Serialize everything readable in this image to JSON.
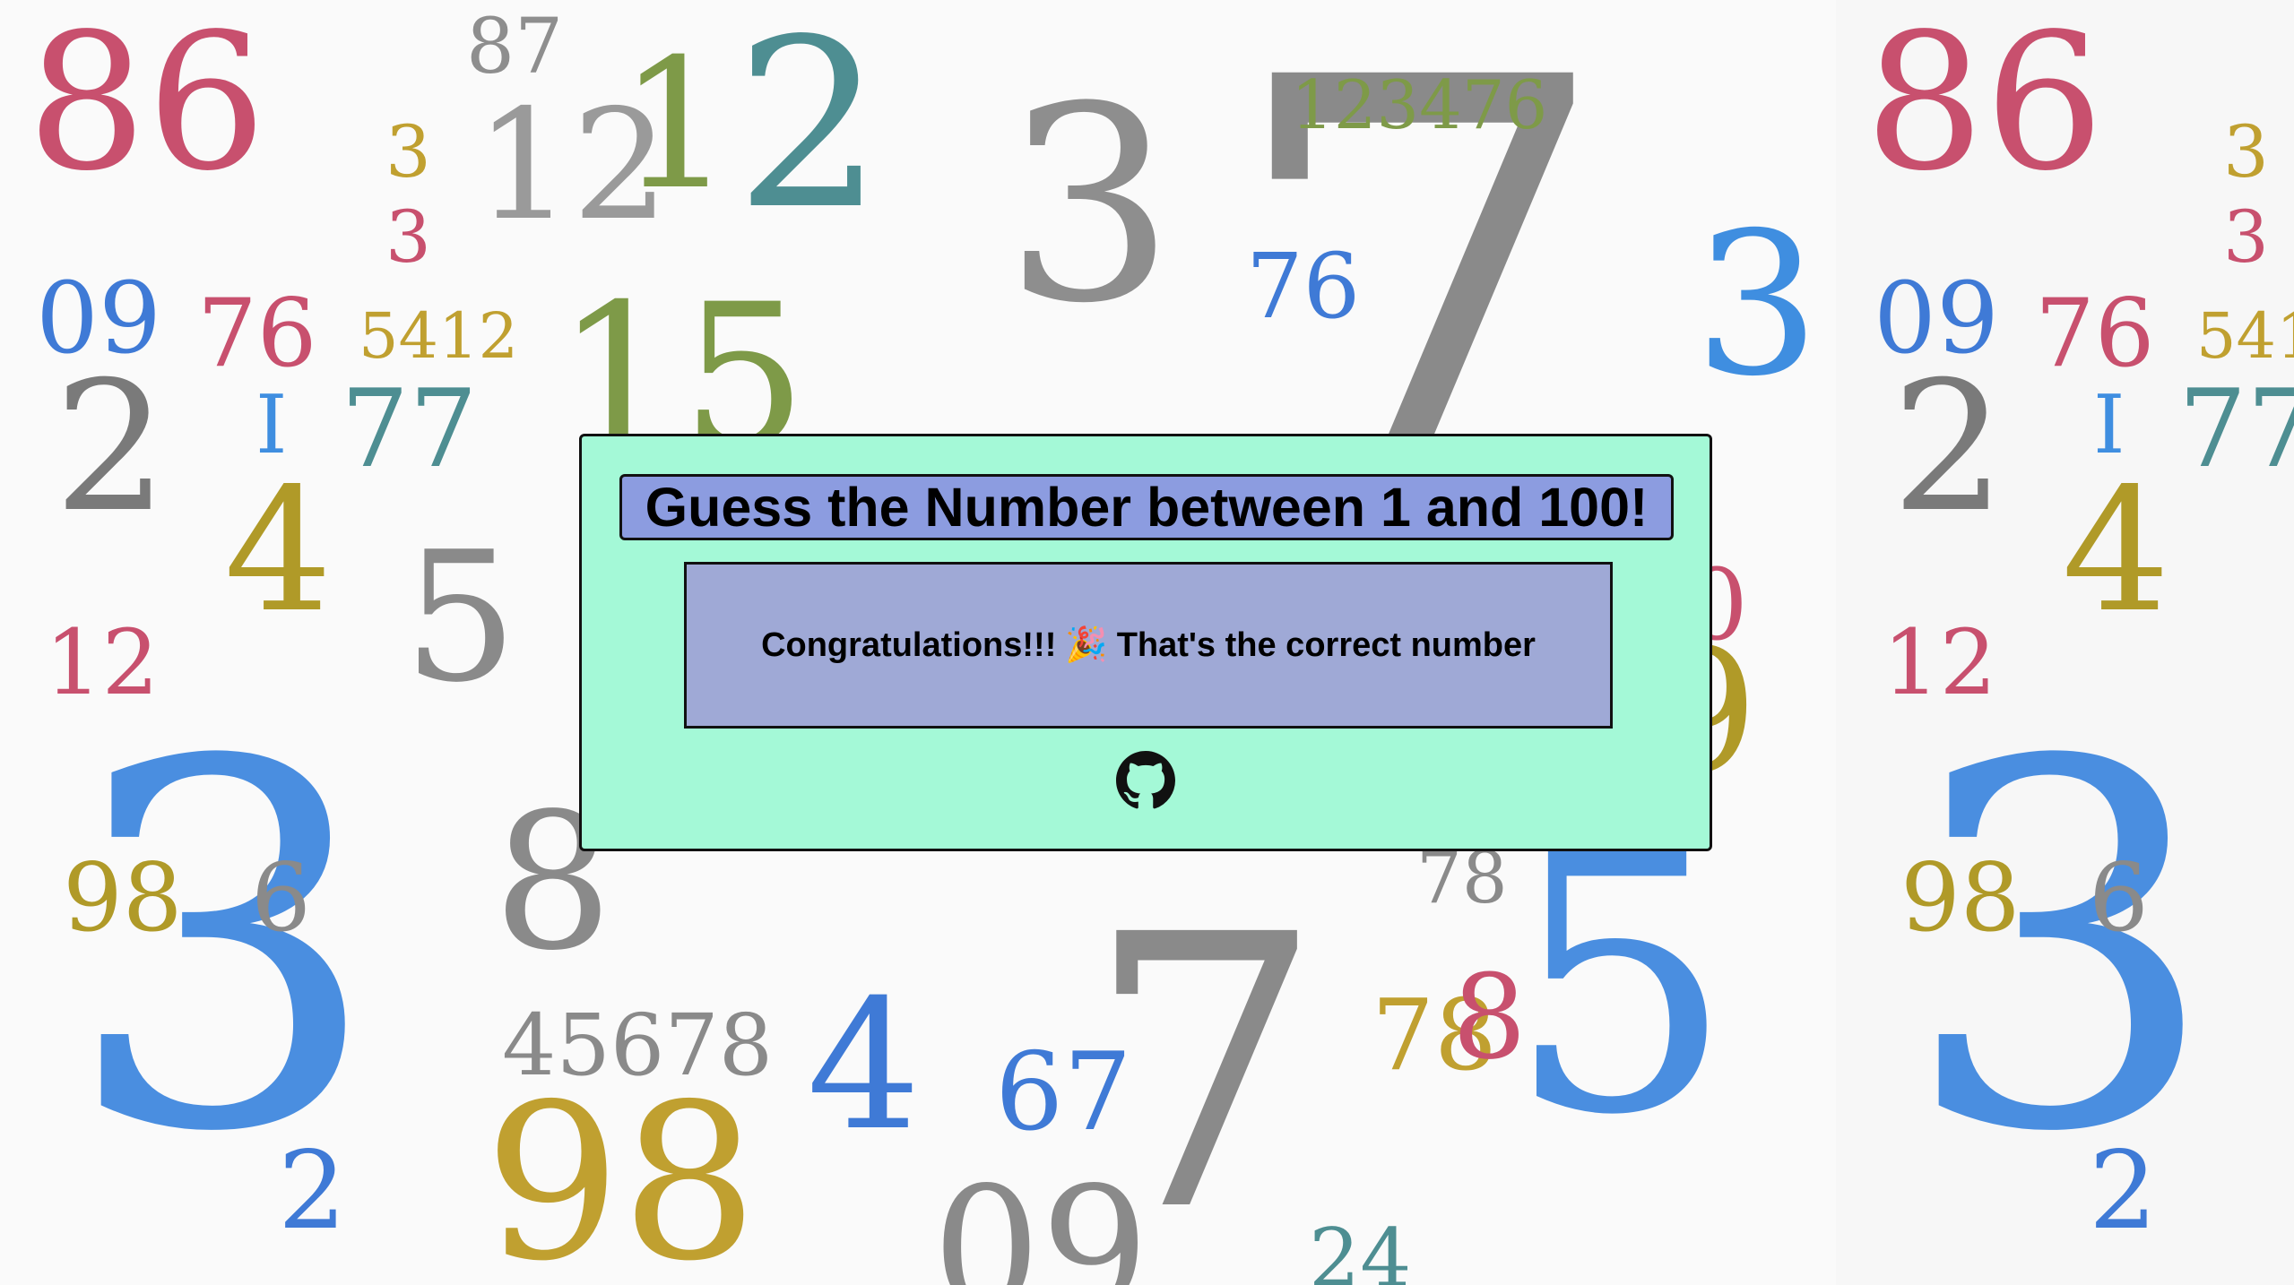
{
  "background": {
    "left_numbers": [
      {
        "t": "86",
        "c": "#c8506e"
      },
      {
        "t": "3",
        "c": "#c0a030"
      },
      {
        "t": "3",
        "c": "#c8506e"
      },
      {
        "t": "87",
        "c": "#8e8e8e"
      },
      {
        "t": "12",
        "c": "#9a9a9a"
      },
      {
        "t": "1",
        "c": "#7e9a48"
      },
      {
        "t": "2",
        "c": "#4e8e92"
      },
      {
        "t": "3",
        "c": "#8e8e8e"
      },
      {
        "t": "7",
        "c": "#8a8a8a"
      },
      {
        "t": "123476",
        "c": "#7e9a48"
      },
      {
        "t": "09",
        "c": "#3f7ad6"
      },
      {
        "t": "76",
        "c": "#c8506e"
      },
      {
        "t": "5412",
        "c": "#c0a030"
      },
      {
        "t": "76",
        "c": "#3f7ad6"
      },
      {
        "t": "15",
        "c": "#7e9a48"
      },
      {
        "t": "3",
        "c": "#3f8ee0"
      },
      {
        "t": "2",
        "c": "#7a7a7a"
      },
      {
        "t": "I",
        "c": "#3f8ee0"
      },
      {
        "t": "77",
        "c": "#4e8e92"
      },
      {
        "t": "4",
        "c": "#b09a28"
      },
      {
        "t": "12",
        "c": "#c8506e"
      },
      {
        "t": "5",
        "c": "#8a8a8a"
      },
      {
        "t": "0",
        "c": "#c8506e"
      },
      {
        "t": "9",
        "c": "#b09a28"
      },
      {
        "t": "3",
        "c": "#4a8ee0"
      },
      {
        "t": "8",
        "c": "#8a8a8a"
      },
      {
        "t": "98",
        "c": "#b09a28"
      },
      {
        "t": "6",
        "c": "#8a8a8a"
      },
      {
        "t": "78",
        "c": "#8a8a8a"
      },
      {
        "t": "5",
        "c": "#4a8ee0"
      },
      {
        "t": "45678",
        "c": "#8a8a8a"
      },
      {
        "t": "4",
        "c": "#3f7ad6"
      },
      {
        "t": "67",
        "c": "#3f7ad6"
      },
      {
        "t": "7",
        "c": "#8a8a8a"
      },
      {
        "t": "78",
        "c": "#c0a030"
      },
      {
        "t": "8",
        "c": "#c8506e"
      },
      {
        "t": "98",
        "c": "#c0a030"
      },
      {
        "t": "09",
        "c": "#8a8a8a"
      },
      {
        "t": "2",
        "c": "#3f7ad6"
      },
      {
        "t": "24",
        "c": "#4e8e92"
      }
    ],
    "right_numbers": [
      {
        "t": "86",
        "c": "#c8506e"
      },
      {
        "t": "3",
        "c": "#c0a030"
      },
      {
        "t": "3",
        "c": "#c8506e"
      },
      {
        "t": "09",
        "c": "#3f7ad6"
      },
      {
        "t": "76",
        "c": "#c8506e"
      },
      {
        "t": "541",
        "c": "#c0a030"
      },
      {
        "t": "2",
        "c": "#7a7a7a"
      },
      {
        "t": "I",
        "c": "#3f8ee0"
      },
      {
        "t": "77",
        "c": "#4e8e92"
      },
      {
        "t": "4",
        "c": "#b09a28"
      },
      {
        "t": "12",
        "c": "#c8506e"
      },
      {
        "t": "3",
        "c": "#4a8ee0"
      },
      {
        "t": "98",
        "c": "#b09a28"
      },
      {
        "t": "6",
        "c": "#8a8a8a"
      },
      {
        "t": "2",
        "c": "#3f7ad6"
      }
    ]
  },
  "game": {
    "title": "Guess the Number between 1 and 100!",
    "message_before": "Congratulations!!!",
    "message_icon": "🎉",
    "message_after": "That's the correct number",
    "github_icon": "github-icon"
  }
}
